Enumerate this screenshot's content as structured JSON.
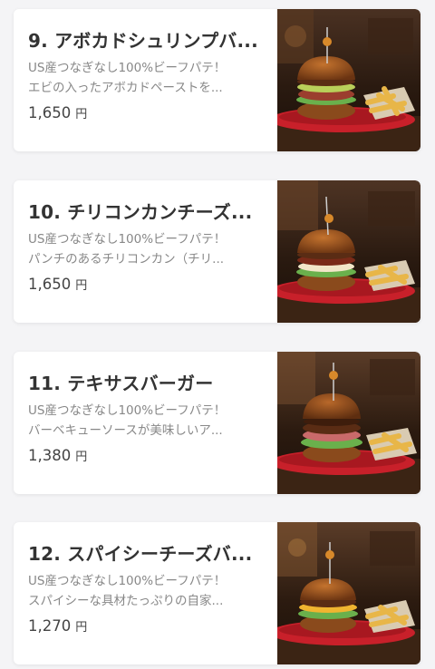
{
  "currency_label": "円",
  "items": [
    {
      "title": "9. アボカドシュリンプバ...",
      "desc_line1": "US産つなぎなし100%ビーフパテ！",
      "desc_line2": "エビの入ったアボカドペーストを...",
      "price": "1,650"
    },
    {
      "title": "10. チリコンカンチーズ...",
      "desc_line1": "US産つなぎなし100%ビーフパテ！",
      "desc_line2": "パンチのあるチリコンカン（チリ...",
      "price": "1,650"
    },
    {
      "title": "11. テキサスバーガー",
      "desc_line1": "US産つなぎなし100%ビーフパテ！",
      "desc_line2": "バーベキューソースが美味しいア...",
      "price": "1,380"
    },
    {
      "title": "12. スパイシーチーズバ...",
      "desc_line1": "US産つなぎなし100%ビーフパテ！",
      "desc_line2": "スパイシーな具材たっぷりの自家...",
      "price": "1,270"
    }
  ],
  "colors": {
    "background": "#f4f4f6",
    "card": "#ffffff",
    "title": "#333333",
    "description": "#888888",
    "price": "#444444",
    "plate": "#c8202a",
    "bun": "#8a4a1c",
    "fries": "#e8b648"
  }
}
